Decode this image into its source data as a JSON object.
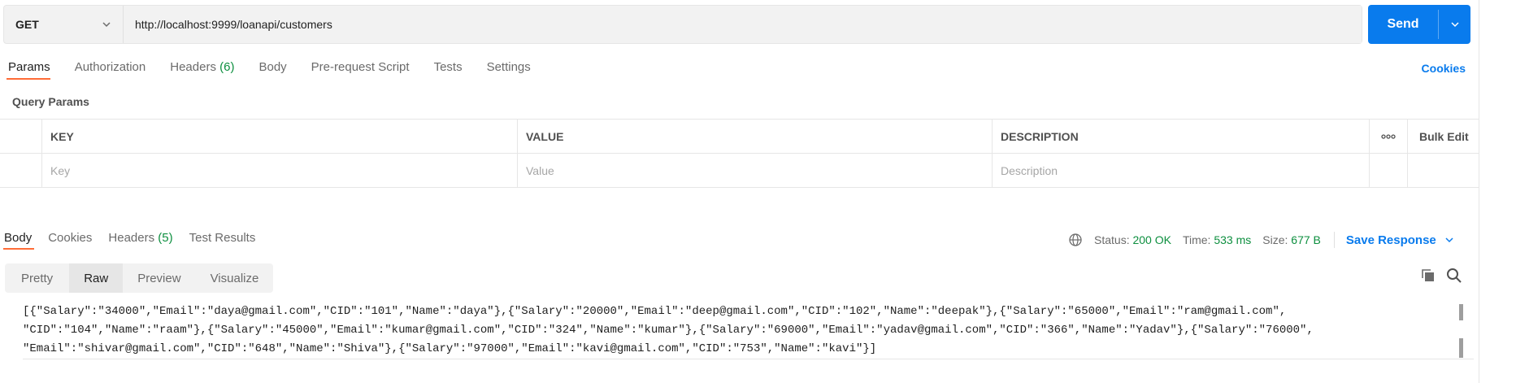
{
  "request": {
    "method": "GET",
    "url": "http://localhost:9999/loanapi/customers",
    "send_label": "Send"
  },
  "request_tabs": [
    {
      "label": "Params",
      "count": ""
    },
    {
      "label": "Authorization",
      "count": ""
    },
    {
      "label": "Headers",
      "count": "(6)"
    },
    {
      "label": "Body",
      "count": ""
    },
    {
      "label": "Pre-request Script",
      "count": ""
    },
    {
      "label": "Tests",
      "count": ""
    },
    {
      "label": "Settings",
      "count": ""
    }
  ],
  "cookies_link": "Cookies",
  "query_params": {
    "title": "Query Params",
    "headers": {
      "key": "KEY",
      "value": "VALUE",
      "description": "DESCRIPTION",
      "bulk_edit": "Bulk Edit"
    },
    "placeholders": {
      "key": "Key",
      "value": "Value",
      "description": "Description"
    }
  },
  "response_tabs": [
    {
      "label": "Body",
      "count": ""
    },
    {
      "label": "Cookies",
      "count": ""
    },
    {
      "label": "Headers",
      "count": "(5)"
    },
    {
      "label": "Test Results",
      "count": ""
    }
  ],
  "status": {
    "status_label": "Status:",
    "status_value": "200 OK",
    "time_label": "Time:",
    "time_value": "533 ms",
    "size_label": "Size:",
    "size_value": "677 B",
    "save_response": "Save Response"
  },
  "format_tabs": [
    "Pretty",
    "Raw",
    "Preview",
    "Visualize"
  ],
  "response_body": {
    "line1": "[{\"Salary\":\"34000\",\"Email\":\"daya@gmail.com\",\"CID\":\"101\",\"Name\":\"daya\"},{\"Salary\":\"20000\",\"Email\":\"deep@gmail.com\",\"CID\":\"102\",\"Name\":\"deepak\"},{\"Salary\":\"65000\",\"Email\":\"ram@gmail.com\",",
    "line2": "\"CID\":\"104\",\"Name\":\"raam\"},{\"Salary\":\"45000\",\"Email\":\"kumar@gmail.com\",\"CID\":\"324\",\"Name\":\"kumar\"},{\"Salary\":\"69000\",\"Email\":\"yadav@gmail.com\",\"CID\":\"366\",\"Name\":\"Yadav\"},{\"Salary\":\"76000\",",
    "line3": "\"Email\":\"shivar@gmail.com\",\"CID\":\"648\",\"Name\":\"Shiva\"},{\"Salary\":\"97000\",\"Email\":\"kavi@gmail.com\",\"CID\":\"753\",\"Name\":\"kavi\"}]"
  },
  "colors": {
    "accent": "#097bed",
    "tab_underline": "#ff6c37",
    "status_green": "#0d8f3f"
  }
}
